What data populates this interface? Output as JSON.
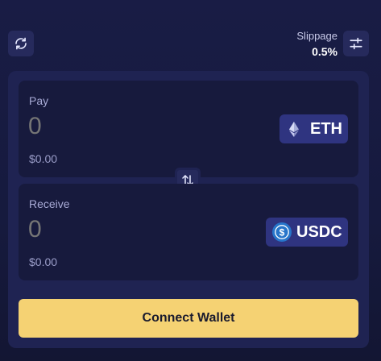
{
  "header": {
    "refresh_icon": "refresh-icon",
    "slippage_label": "Slippage",
    "slippage_value": "0.5%",
    "settings_icon": "sliders-icon"
  },
  "pay": {
    "label": "Pay",
    "amount_placeholder": "0",
    "fiat_value": "$0.00",
    "token": {
      "symbol": "ETH",
      "icon": "ethereum-icon"
    }
  },
  "flip": {
    "icon": "swap-arrows-icon"
  },
  "receive": {
    "label": "Receive",
    "amount_placeholder": "0",
    "fiat_value": "$0.00",
    "token": {
      "symbol": "USDC",
      "icon": "usdc-icon"
    }
  },
  "connect_button": {
    "label": "Connect Wallet"
  },
  "colors": {
    "background": "#171a3e",
    "card": "#1f2352",
    "panel": "#171a3d",
    "token_button": "#2f3480",
    "accent": "#f5d273",
    "usdc_blue": "#2775ca"
  }
}
